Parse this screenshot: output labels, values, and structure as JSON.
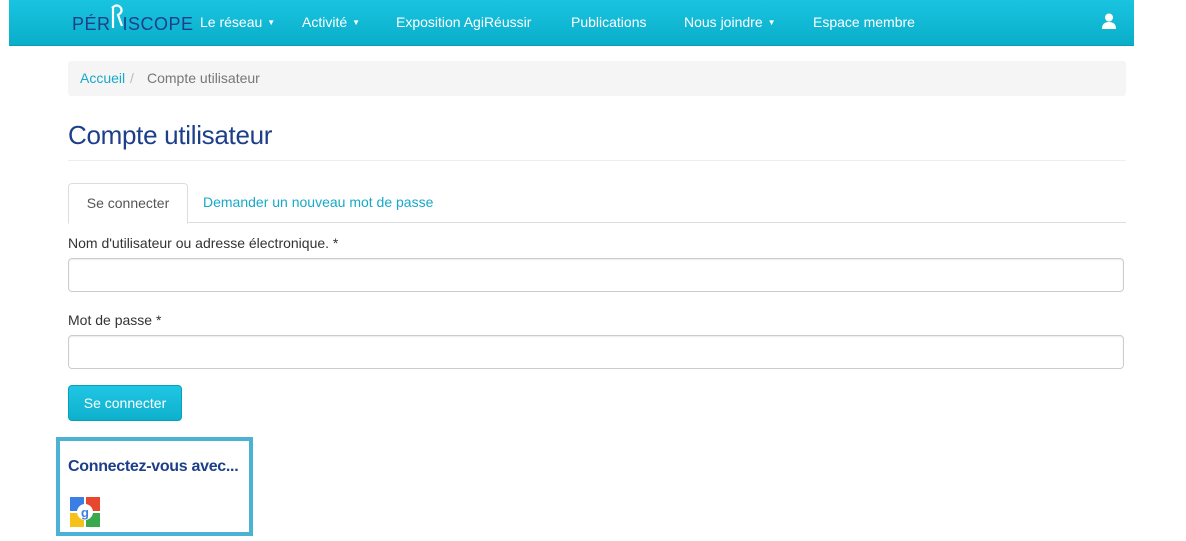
{
  "navbar": {
    "logo": {
      "left": "PÉR",
      "right": "ISCOPE"
    },
    "items": [
      {
        "label": "Le réseau",
        "dropdown": true
      },
      {
        "label": "Activité",
        "dropdown": true
      },
      {
        "label": "Exposition AgiRéussir",
        "dropdown": false
      },
      {
        "label": "Publications",
        "dropdown": false
      },
      {
        "label": "Nous joindre",
        "dropdown": true
      },
      {
        "label": "Espace membre",
        "dropdown": false
      }
    ],
    "user_icon": "user-icon"
  },
  "breadcrumb": {
    "home": "Accueil",
    "separator": "/",
    "current": "Compte utilisateur"
  },
  "page": {
    "title": "Compte utilisateur"
  },
  "tabs": {
    "active": "Se connecter",
    "other": "Demander un nouveau mot de passe"
  },
  "form": {
    "username_label": "Nom d'utilisateur ou adresse électronique. *",
    "username_value": "",
    "password_label": "Mot de passe *",
    "password_value": "",
    "submit_label": "Se connecter"
  },
  "social": {
    "title": "Connectez-vous avec...",
    "providers": [
      "google-icon"
    ]
  },
  "colors": {
    "navbar": "#11bad6",
    "brand_dark": "#1d3f8a",
    "link": "#17a9c8",
    "highlight_border": "#4bb2d3"
  }
}
